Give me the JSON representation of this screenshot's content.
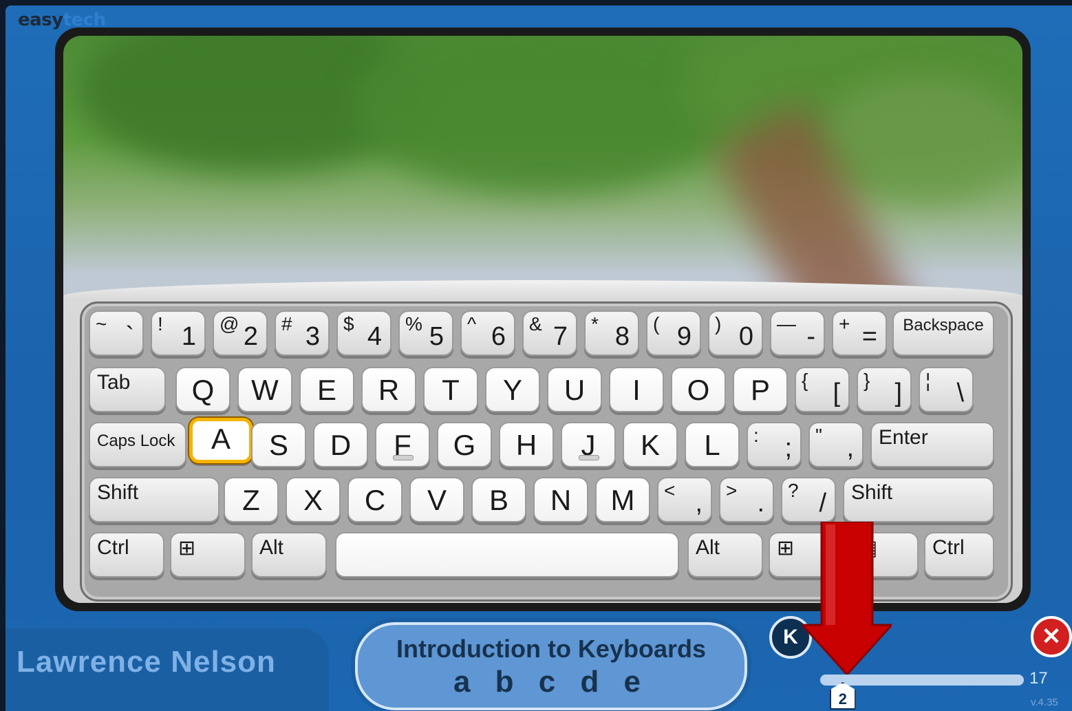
{
  "brand": {
    "part1": "easy",
    "part2": "tech"
  },
  "keyboard": {
    "row1": [
      {
        "shift": "~",
        "low": "`"
      },
      {
        "shift": "!",
        "low": "1"
      },
      {
        "shift": "@",
        "low": "2"
      },
      {
        "shift": "#",
        "low": "3"
      },
      {
        "shift": "$",
        "low": "4"
      },
      {
        "shift": "%",
        "low": "5"
      },
      {
        "shift": "^",
        "low": "6"
      },
      {
        "shift": "&",
        "low": "7"
      },
      {
        "shift": "*",
        "low": "8"
      },
      {
        "shift": "(",
        "low": "9"
      },
      {
        "shift": ")",
        "low": "0"
      },
      {
        "shift": "—",
        "low": "-"
      },
      {
        "shift": "+",
        "low": "="
      }
    ],
    "backspace": "Backspace",
    "tab": "Tab",
    "row2": [
      "Q",
      "W",
      "E",
      "R",
      "T",
      "Y",
      "U",
      "I",
      "O",
      "P"
    ],
    "row2_symbols": [
      {
        "shift": "{",
        "low": "["
      },
      {
        "shift": "}",
        "low": "]"
      },
      {
        "shift": "¦",
        "low": "\\"
      }
    ],
    "caps_lock": "Caps Lock",
    "row3": [
      "A",
      "S",
      "D",
      "F",
      "G",
      "H",
      "J",
      "K",
      "L"
    ],
    "row3_symbols": [
      {
        "shift": ":",
        "low": ";"
      },
      {
        "shift": "\"",
        "low": ","
      }
    ],
    "enter": "Enter",
    "shift_left": "Shift",
    "row4": [
      "Z",
      "X",
      "C",
      "V",
      "B",
      "N",
      "M"
    ],
    "row4_symbols": [
      {
        "shift": "<",
        "low": ","
      },
      {
        "shift": ">",
        "low": "."
      },
      {
        "shift": "?",
        "low": "/"
      }
    ],
    "shift_right": "Shift",
    "ctrl_left": "Ctrl",
    "win_left": "⊞",
    "alt_left": "Alt",
    "alt_right": "Alt",
    "win_right": "⊞",
    "menu": "▤",
    "ctrl_right": "Ctrl",
    "highlighted_key": "A"
  },
  "footer": {
    "user_name": "Lawrence Nelson",
    "lesson_title": "Introduction to Keyboards",
    "lesson_subtitle": "a b c d e",
    "back_label": "K",
    "close_label": "✕",
    "current_step": "2",
    "total_steps": "17",
    "progress": 0.06,
    "version": "v.4.35"
  },
  "icons": [
    "back-icon",
    "close-icon",
    "windows-icon",
    "menu-icon",
    "down-arrow-icon"
  ],
  "colors": {
    "accent": "#f5b400",
    "frame": "#1f6db8",
    "arrow": "#c80000"
  }
}
